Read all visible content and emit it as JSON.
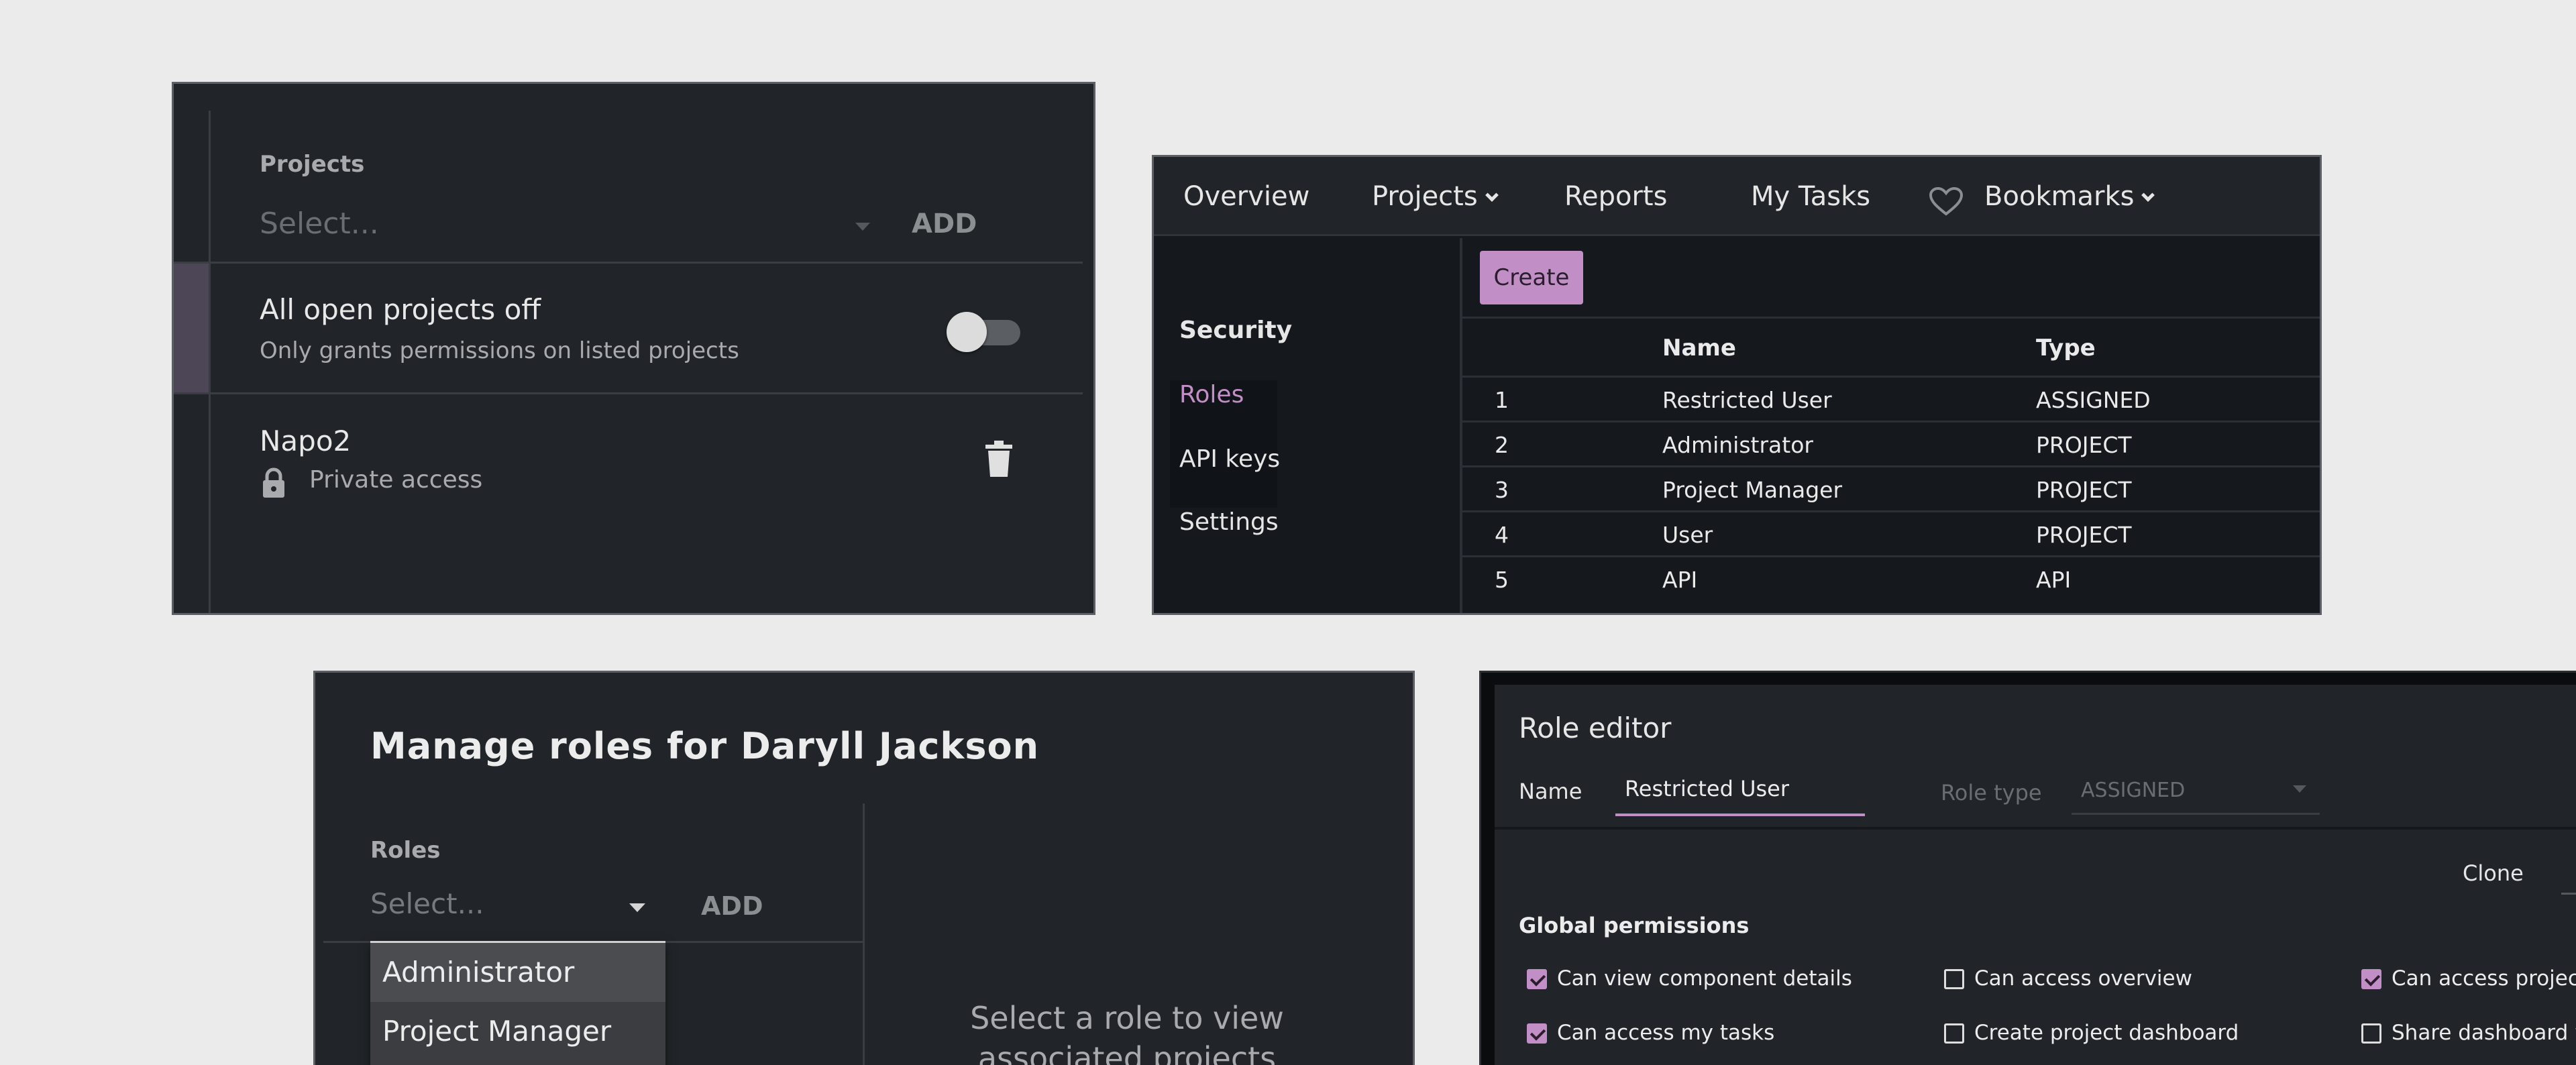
{
  "projects_panel": {
    "label": "Projects",
    "select_placeholder": "Select...",
    "add_label": "ADD",
    "toggle_title": "All open projects off",
    "toggle_subtitle": "Only grants permissions on listed projects",
    "toggle_on": false,
    "project_name": "Napo2",
    "project_access": "Private access"
  },
  "admin_panel": {
    "nav": {
      "overview": "Overview",
      "projects": "Projects",
      "reports": "Reports",
      "my_tasks": "My Tasks",
      "bookmarks": "Bookmarks"
    },
    "sidebar": {
      "security": "Security",
      "roles": "Roles",
      "api_keys": "API keys",
      "settings": "Settings"
    },
    "create_label": "Create",
    "table": {
      "headers": {
        "name": "Name",
        "type": "Type"
      },
      "rows": [
        {
          "id": "1",
          "name": "Restricted User",
          "type": "ASSIGNED"
        },
        {
          "id": "2",
          "name": "Administrator",
          "type": "PROJECT"
        },
        {
          "id": "3",
          "name": "Project Manager",
          "type": "PROJECT"
        },
        {
          "id": "4",
          "name": "User",
          "type": "PROJECT"
        },
        {
          "id": "5",
          "name": "API",
          "type": "API"
        }
      ]
    },
    "accent_color": "#c18fc5"
  },
  "manage_roles": {
    "title": "Manage roles for Daryll Jackson",
    "roles_label": "Roles",
    "select_placeholder": "Select...",
    "add_label": "ADD",
    "dropdown_options": [
      "Administrator",
      "Project Manager"
    ],
    "empty_message": "Select a role to view associated projects"
  },
  "role_editor": {
    "title": "Role editor",
    "name_label": "Name",
    "name_value": "Restricted User",
    "role_type_label": "Role type",
    "role_type_value": "ASSIGNED",
    "clone_label": "Clone",
    "global_permissions_label": "Global permissions",
    "permissions": [
      {
        "label": "Can view component details",
        "checked": true
      },
      {
        "label": "Can access overview",
        "checked": false
      },
      {
        "label": "Can access projects",
        "checked": true
      },
      {
        "label": "Can access my tasks",
        "checked": true
      },
      {
        "label": "Create project dashboard",
        "checked": false
      },
      {
        "label": "Share dashboard wi",
        "checked": false
      }
    ]
  }
}
